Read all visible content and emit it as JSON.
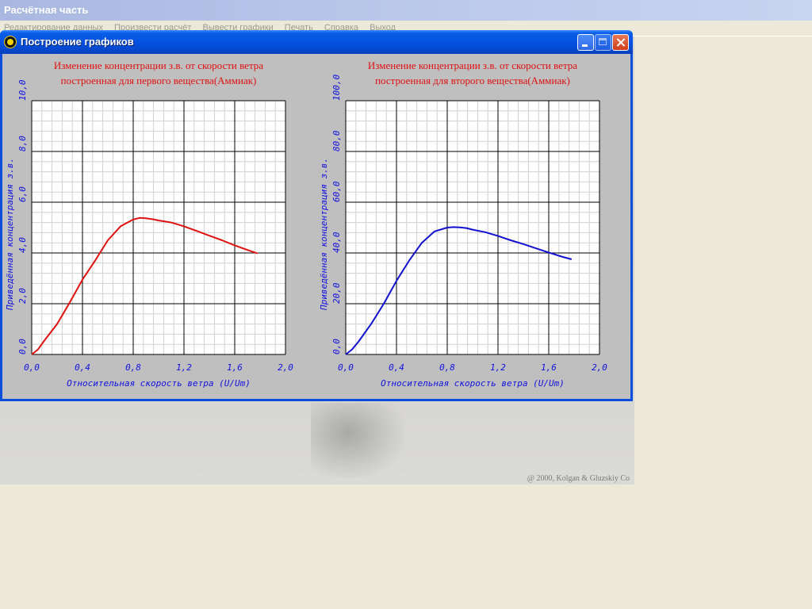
{
  "app": {
    "title": "Расчётная часть",
    "menu": [
      "Редактирование данных",
      "Произвести расчёт",
      "Вывести графики",
      "Печать",
      "Справка",
      "Выход"
    ],
    "copyright": "@ 2000,  Kolgan & Gluzskiy Co"
  },
  "dialog": {
    "title": "Построение графиков",
    "icon": "radiation-icon"
  },
  "colors": {
    "grid_minor": "#d0d0d0",
    "grid_major": "#000000",
    "axis_text": "#1010e0",
    "title_text": "#e01010",
    "series1": "#e01010",
    "series2": "#1010d0"
  },
  "chart_data": [
    {
      "type": "line",
      "title_line1": "Изменение концентрации з.в. от скорости ветра",
      "title_line2": "построенная для первого вещества(Аммиак)",
      "xlabel": "Относительная скорость ветра (U/Um)",
      "ylabel": "Приведённая концентрация з.в.",
      "xlim": [
        0,
        2.0
      ],
      "ylim": [
        0,
        10.0
      ],
      "xticks": [
        "0,0",
        "0,4",
        "0,8",
        "1,2",
        "1,6",
        "2,0"
      ],
      "yticks": [
        "0,0",
        "2,0",
        "4,0",
        "6,0",
        "8,0",
        "10,0"
      ],
      "grid": true,
      "series": [
        {
          "color": "#e01010",
          "x": [
            0,
            0.05,
            0.1,
            0.2,
            0.3,
            0.4,
            0.5,
            0.6,
            0.7,
            0.8,
            0.85,
            0.9,
            0.95,
            1.0,
            1.1,
            1.2,
            1.3,
            1.4,
            1.5,
            1.6,
            1.7,
            1.78
          ],
          "y": [
            0,
            0.2,
            0.55,
            1.2,
            2.05,
            2.95,
            3.7,
            4.5,
            5.05,
            5.32,
            5.38,
            5.37,
            5.33,
            5.28,
            5.2,
            5.05,
            4.87,
            4.68,
            4.5,
            4.3,
            4.12,
            3.98
          ]
        }
      ]
    },
    {
      "type": "line",
      "title_line1": "Изменение концентрации з.в. от скорости ветра",
      "title_line2": "построенная для второго вещества(Аммиак)",
      "xlabel": "Относительная скорость ветра (U/Um)",
      "ylabel": "Приведённая концентрация з.в.",
      "xlim": [
        0,
        2.0
      ],
      "ylim": [
        0,
        100.0
      ],
      "xticks": [
        "0,0",
        "0,4",
        "0,8",
        "1,2",
        "1,6",
        "2,0"
      ],
      "yticks": [
        "0,0",
        "20,0",
        "40,0",
        "60,0",
        "80,0",
        "100,0"
      ],
      "grid": true,
      "series": [
        {
          "color": "#1010d0",
          "x": [
            0,
            0.05,
            0.1,
            0.2,
            0.3,
            0.4,
            0.5,
            0.6,
            0.7,
            0.8,
            0.85,
            0.9,
            0.95,
            1.0,
            1.1,
            1.2,
            1.3,
            1.4,
            1.5,
            1.6,
            1.7,
            1.78
          ],
          "y": [
            0,
            2,
            5,
            12,
            20,
            29,
            37,
            44,
            48.5,
            50,
            50.2,
            50.1,
            49.8,
            49.2,
            48.2,
            46.7,
            45,
            43.5,
            41.8,
            40.2,
            38.6,
            37.5
          ]
        }
      ]
    }
  ]
}
